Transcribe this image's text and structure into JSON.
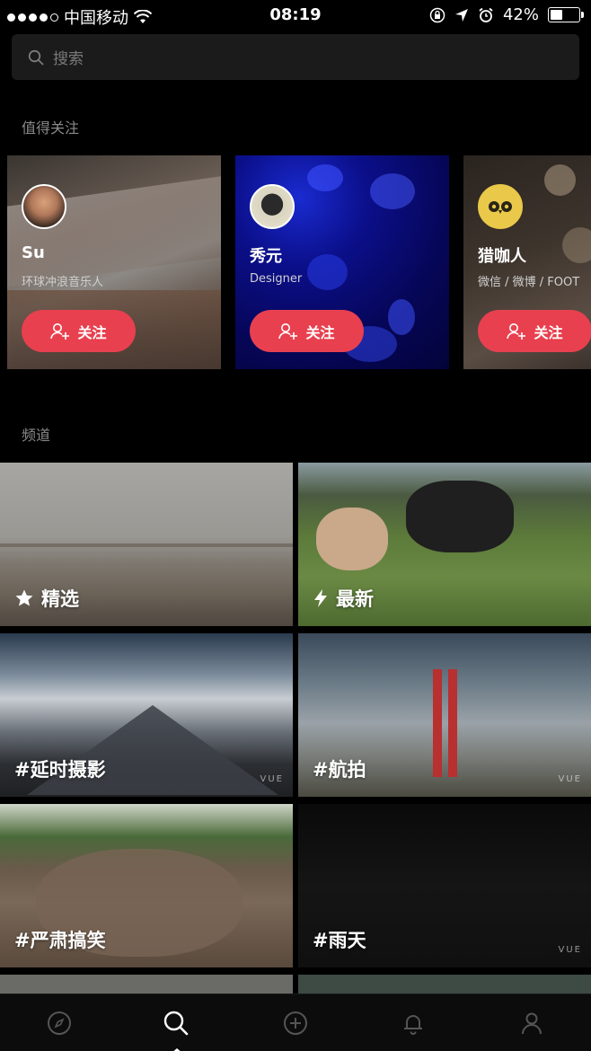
{
  "status_bar": {
    "carrier": "中国移动",
    "time": "08:19",
    "battery": "42%",
    "battery_level": 0.42
  },
  "search": {
    "placeholder": "搜索"
  },
  "featured": {
    "title": "值得关注",
    "users": [
      {
        "name": "Su",
        "desc": "环球冲浪音乐人",
        "follow_label": "关注"
      },
      {
        "name": "秀元",
        "desc": "Designer",
        "follow_label": "关注"
      },
      {
        "name": "猎咖人",
        "desc": "微信 / 微博 / FOOT",
        "follow_label": "关注"
      }
    ]
  },
  "channels": {
    "title": "频道",
    "items": [
      {
        "label": "精选",
        "icon": "star-icon"
      },
      {
        "label": "最新",
        "icon": "lightning-icon"
      },
      {
        "label": "#延时摄影",
        "watermark": "VUE"
      },
      {
        "label": "#航拍",
        "watermark": "VUE"
      },
      {
        "label": "#严肃搞笑"
      },
      {
        "label": "#雨天",
        "watermark": "VUE"
      }
    ]
  },
  "tab_bar": {
    "items": [
      "compass-icon",
      "search-icon",
      "add-icon",
      "bell-icon",
      "profile-icon"
    ],
    "active": "search-icon"
  }
}
